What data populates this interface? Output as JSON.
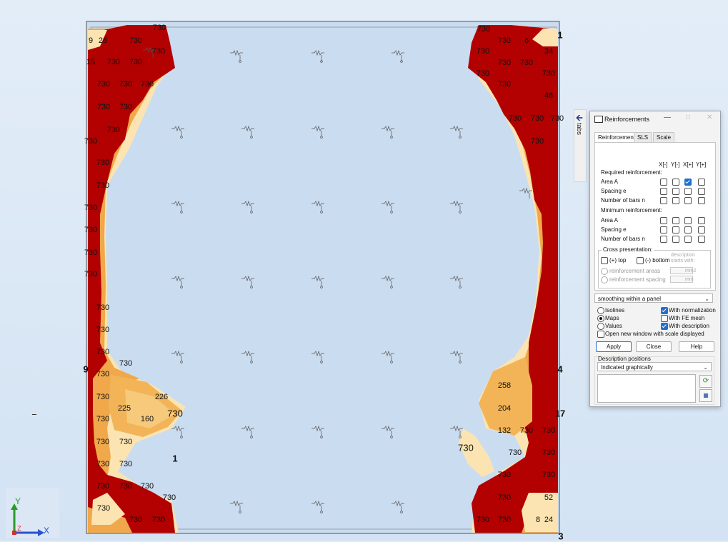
{
  "colors": {
    "background": "#dfeaf6",
    "panel_fill": "#c9dcf1",
    "reinf_max": "#b30000",
    "reinf_high": "#d95a1a",
    "reinf_mid": "#f2b457",
    "reinf_low": "#fbe4b1",
    "accent": "#1f6fd1"
  },
  "map": {
    "nodes": [
      {
        "id": "1",
        "label": "1"
      },
      {
        "id": "3",
        "label": "3"
      },
      {
        "id": "4",
        "label": "4"
      },
      {
        "id": "9",
        "label": "9"
      },
      {
        "id": "17",
        "label": "17"
      },
      {
        "id": "1b",
        "label": "1"
      }
    ],
    "values": [
      "9",
      "28",
      "730",
      "730",
      "730",
      "6",
      "34",
      "15",
      "730",
      "730",
      "730",
      "730",
      "730",
      "730",
      "730",
      "730",
      "730",
      "730",
      "730",
      "730",
      "730",
      "730",
      "730",
      "730",
      "730",
      "730",
      "730",
      "730",
      "730",
      "730",
      "730",
      "730",
      "730",
      "730",
      "730",
      "730",
      "730",
      "730",
      "730",
      "730",
      "730",
      "730",
      "730",
      "730",
      "730",
      "730",
      "730",
      "730",
      "226",
      "225",
      "160",
      "730",
      "258",
      "204",
      "132",
      "730",
      "730",
      "730",
      "730",
      "730",
      "730",
      "730",
      "730",
      "730",
      "730",
      "730",
      "46",
      "730",
      "730",
      "730",
      "730",
      "52",
      "8",
      "24"
    ]
  },
  "triad": {
    "x": "X",
    "y": "Y",
    "z": "Z"
  },
  "tabs_strip": {
    "label": "tabs"
  },
  "dialog": {
    "title": "Reinforcements",
    "tabs": [
      "Reinforcement",
      "SLS",
      "Scale"
    ],
    "columns": [
      "X[-]",
      "Y[-]",
      "X[+]",
      "Y[+]"
    ],
    "required_label": "Required reinforcement:",
    "required_rows": [
      {
        "label": "Area A",
        "checks": [
          false,
          false,
          true,
          false
        ]
      },
      {
        "label": "Spacing e",
        "checks": [
          false,
          false,
          false,
          false
        ]
      },
      {
        "label": "Number of bars n",
        "checks": [
          false,
          false,
          false,
          false
        ]
      }
    ],
    "minimum_label": "Minimum reinforcement:",
    "minimum_rows": [
      {
        "label": "Area A",
        "checks": [
          false,
          false,
          false,
          false
        ]
      },
      {
        "label": "Spacing e",
        "checks": [
          false,
          false,
          false,
          false
        ]
      },
      {
        "label": "Number of bars n",
        "checks": [
          false,
          false,
          false,
          false
        ]
      }
    ],
    "cross": {
      "title": "Cross presentation:",
      "top": "(+) top",
      "bottom": "(-) bottom",
      "desc": "description starts with:",
      "areas": "reinforcement areas",
      "spacing": "reinforcement spacing",
      "unit_area": "mm2",
      "unit_spacing": "mm"
    },
    "smoothing": "smoothing within a panel",
    "display": {
      "isolines": "Isolines",
      "maps": "Maps",
      "values": "Values",
      "selected": "Maps",
      "normalization": "With normalization",
      "normalization_on": true,
      "fe_mesh": "With FE mesh",
      "fe_mesh_on": false,
      "description": "With description",
      "description_on": true,
      "new_window": "Open new window with scale displayed",
      "new_window_on": false
    },
    "buttons": {
      "apply": "Apply",
      "close": "Close",
      "help": "Help"
    },
    "desc_positions": {
      "title": "Description positions",
      "value": "Indicated graphically"
    }
  }
}
